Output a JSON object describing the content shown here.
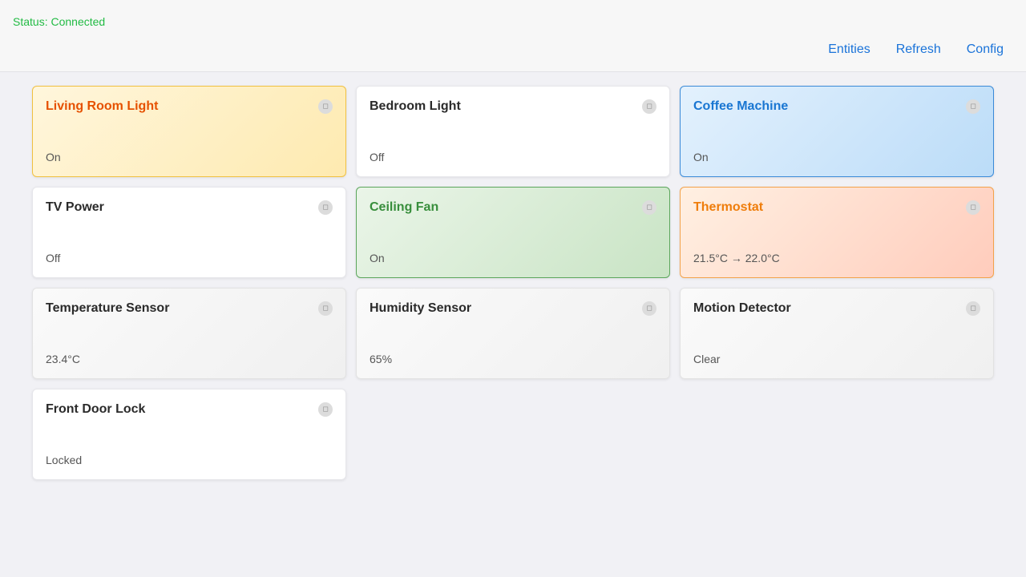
{
  "header": {
    "status": "Status: Connected",
    "nav": {
      "entities": "Entities",
      "refresh": "Refresh",
      "config": "Config"
    }
  },
  "cards": [
    {
      "title": "Living Room Light",
      "state": "On",
      "icon": "device-icon"
    },
    {
      "title": "Bedroom Light",
      "state": "Off",
      "icon": "device-icon"
    },
    {
      "title": "Coffee Machine",
      "state": "On",
      "icon": "device-icon"
    },
    {
      "title": "TV Power",
      "state": "Off",
      "icon": "device-icon"
    },
    {
      "title": "Ceiling Fan",
      "state": "On",
      "icon": "device-icon"
    },
    {
      "title": "Thermostat",
      "state": "21.5°C → 22.0°C",
      "icon": "device-icon"
    },
    {
      "title": "Temperature Sensor",
      "state": "23.4°C",
      "icon": "device-icon"
    },
    {
      "title": "Humidity Sensor",
      "state": "65%",
      "icon": "device-icon"
    },
    {
      "title": "Motion Detector",
      "state": "Clear",
      "icon": "device-icon"
    },
    {
      "title": "Front Door Lock",
      "state": "Locked",
      "icon": "device-icon"
    }
  ],
  "colors": {
    "status_connected": "#22bb44",
    "link": "#1a73d9",
    "light_on": "#e65100",
    "switch_on": "#1976d2",
    "fan_on": "#388e3c",
    "climate": "#ef7d0b"
  }
}
